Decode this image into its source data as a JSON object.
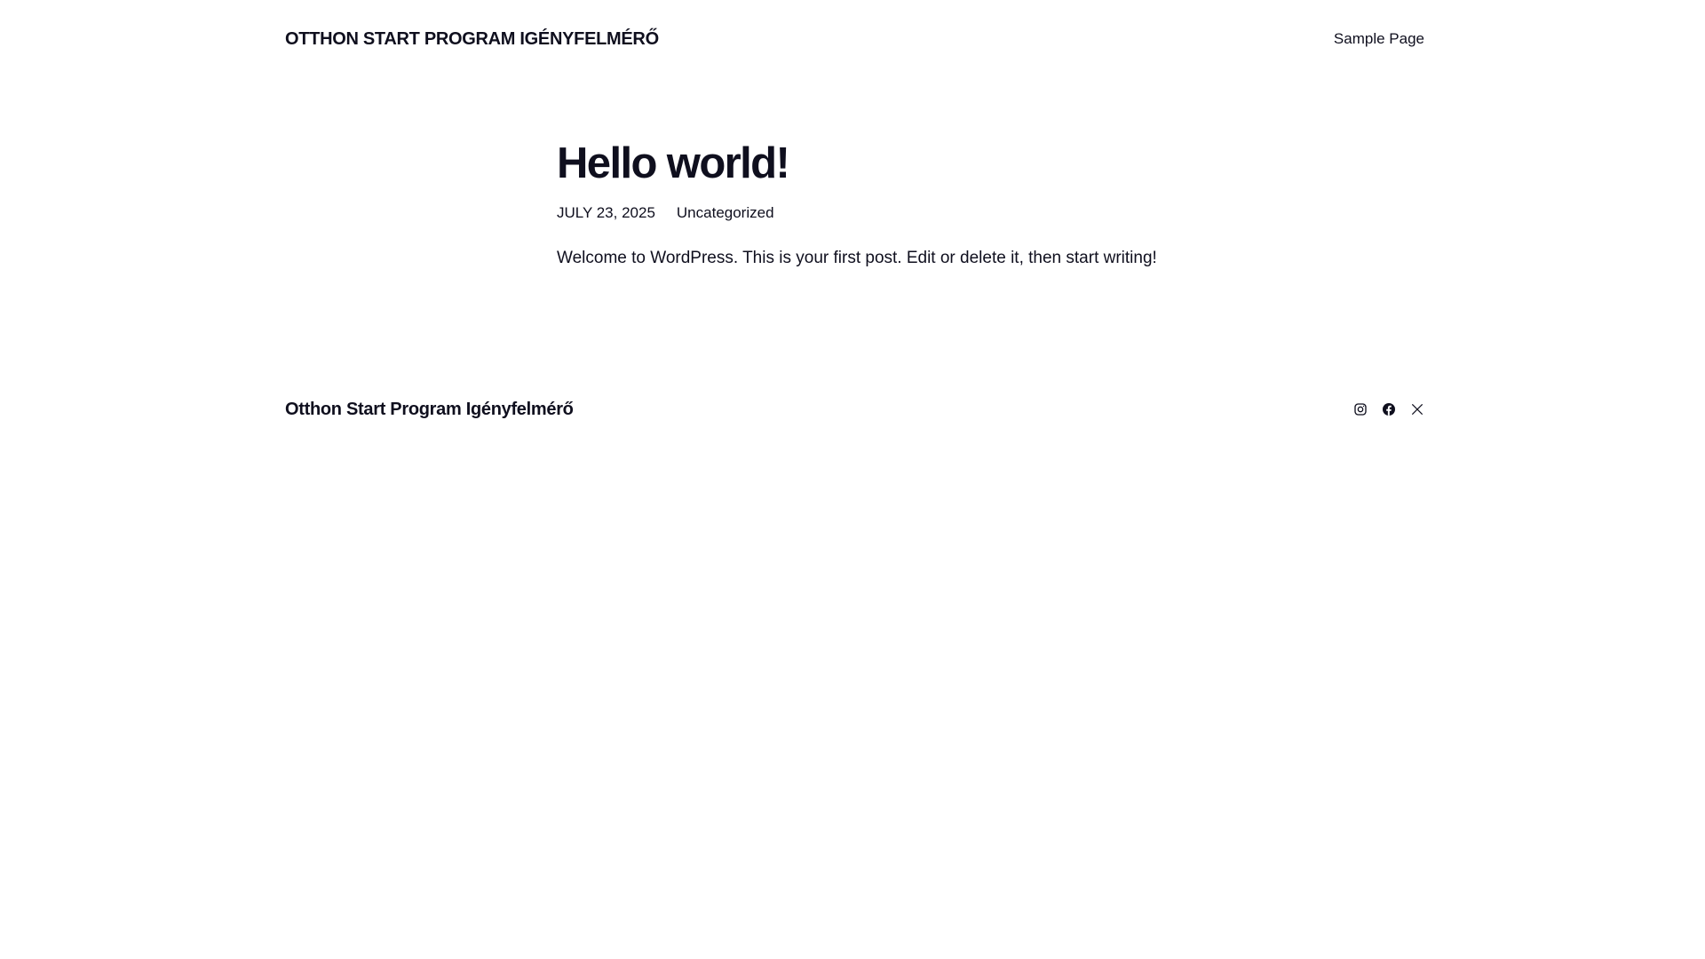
{
  "header": {
    "site_title": "OTTHON START PROGRAM IGÉNYFELMÉRŐ",
    "nav": [
      {
        "label": "Sample Page"
      }
    ]
  },
  "post": {
    "title": "Hello world!",
    "date": "JULY 23, 2025",
    "category": "Uncategorized",
    "content": "Welcome to WordPress. This is your first post. Edit or delete it, then start writing!"
  },
  "footer": {
    "site_title": "Otthon Start Program Igényfelmérő",
    "social": [
      {
        "icon": "instagram-icon"
      },
      {
        "icon": "facebook-icon"
      },
      {
        "icon": "x-icon"
      }
    ]
  },
  "colors": {
    "text": "#0f0f1e",
    "background": "#ffffff"
  }
}
